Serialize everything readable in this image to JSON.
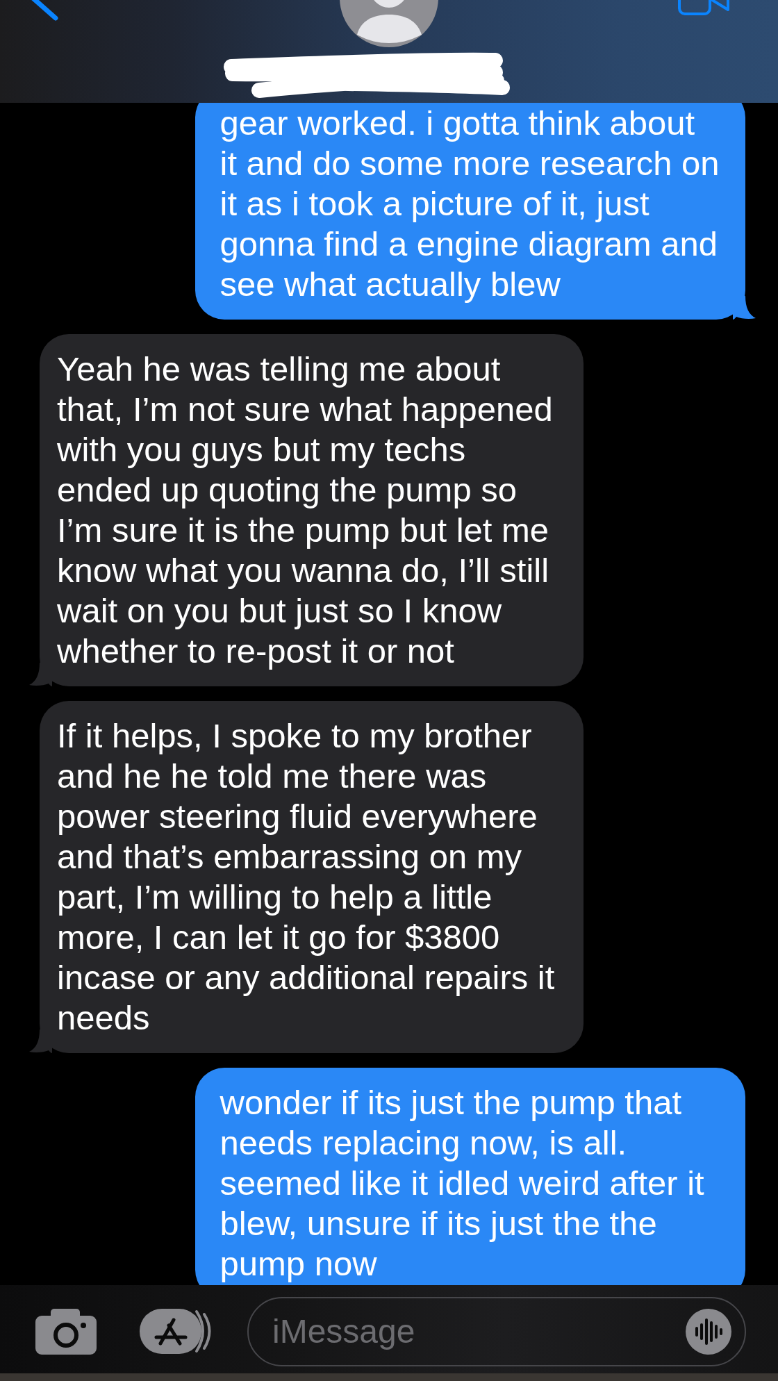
{
  "messages": [
    {
      "kind": "sent",
      "text": "gear worked. i gotta think about it and do some more research on it as i took a picture of it, just gonna find a engine diagram and see what actually blew",
      "tail": true
    },
    {
      "kind": "received",
      "text": "Yeah he was telling me about that, I’m not sure what happened with you guys but my techs ended up quoting the pump so I’m sure it is the pump but let me know what you wanna do, I’ll still wait on you but just so I know whether to re-post it or not",
      "tail": true
    },
    {
      "kind": "received",
      "text": "If it helps, I spoke to my brother and he he told me there was power steering fluid everywhere and that’s embarrassing on my part, I’m willing to help a little more, I can let it go for $3800 incase or any additional repairs it needs",
      "tail": true
    },
    {
      "kind": "sent",
      "text": "wonder if its just the pump that needs replacing now, is all. seemed like it idled weird after it blew, unsure if its just the the pump now",
      "tail": false
    }
  ],
  "composer": {
    "placeholder": "iMessage"
  }
}
